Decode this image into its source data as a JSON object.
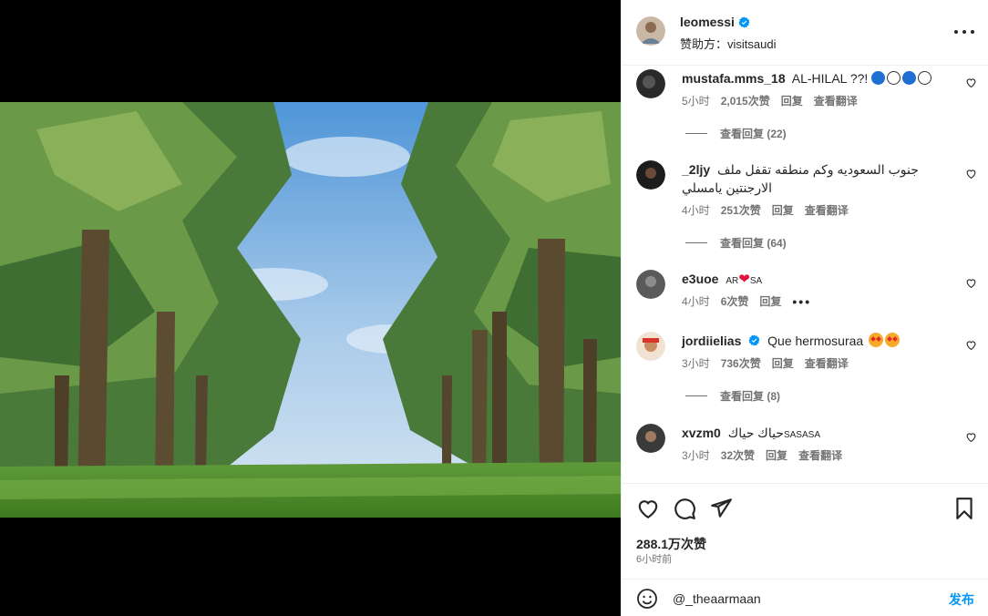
{
  "header": {
    "username": "leomessi",
    "sponsor": "赞助方：visitsaudi"
  },
  "comments": [
    {
      "username": "mustafa.mms_18",
      "text": "AL-HILAL ??!",
      "time": "5小时",
      "likes": "2,015次赞",
      "reply": "回复",
      "translate": "查看翻译",
      "view_replies": "查看回复 (22)"
    },
    {
      "username": "_2ljy",
      "text": "جنوب السعوديه وكم منطقه تقفل ملف الارجنتين يامسلي",
      "time": "4小时",
      "likes": "251次赞",
      "reply": "回复",
      "translate": "查看翻译",
      "view_replies": "查看回复 (64)"
    },
    {
      "username": "e3uoe",
      "text_pre": "AR",
      "text_post": "SA",
      "time": "4小时",
      "likes": "6次赞",
      "reply": "回复"
    },
    {
      "username": "jordiielias",
      "text": "Que hermosuraa",
      "time": "3小时",
      "likes": "736次赞",
      "reply": "回复",
      "translate": "查看翻译",
      "view_replies": "查看回复 (8)"
    },
    {
      "username": "xvzm0",
      "text": "حياك حياك",
      "text_suffix": "SASASA",
      "time": "3小时",
      "likes": "32次赞",
      "reply": "回复",
      "translate": "查看翻译"
    }
  ],
  "footer": {
    "likes": "288.1万次赞",
    "time": "6小时前",
    "input_value": "@_theaarmaan",
    "post_label": "发布"
  },
  "colors": {
    "link_blue": "#0095f6",
    "verified_blue": "#0095f6",
    "muted": "#737373"
  },
  "icons": [
    "heart-icon",
    "comment-icon",
    "share-icon",
    "bookmark-icon",
    "emoji-icon",
    "verified-icon",
    "more-icon"
  ]
}
